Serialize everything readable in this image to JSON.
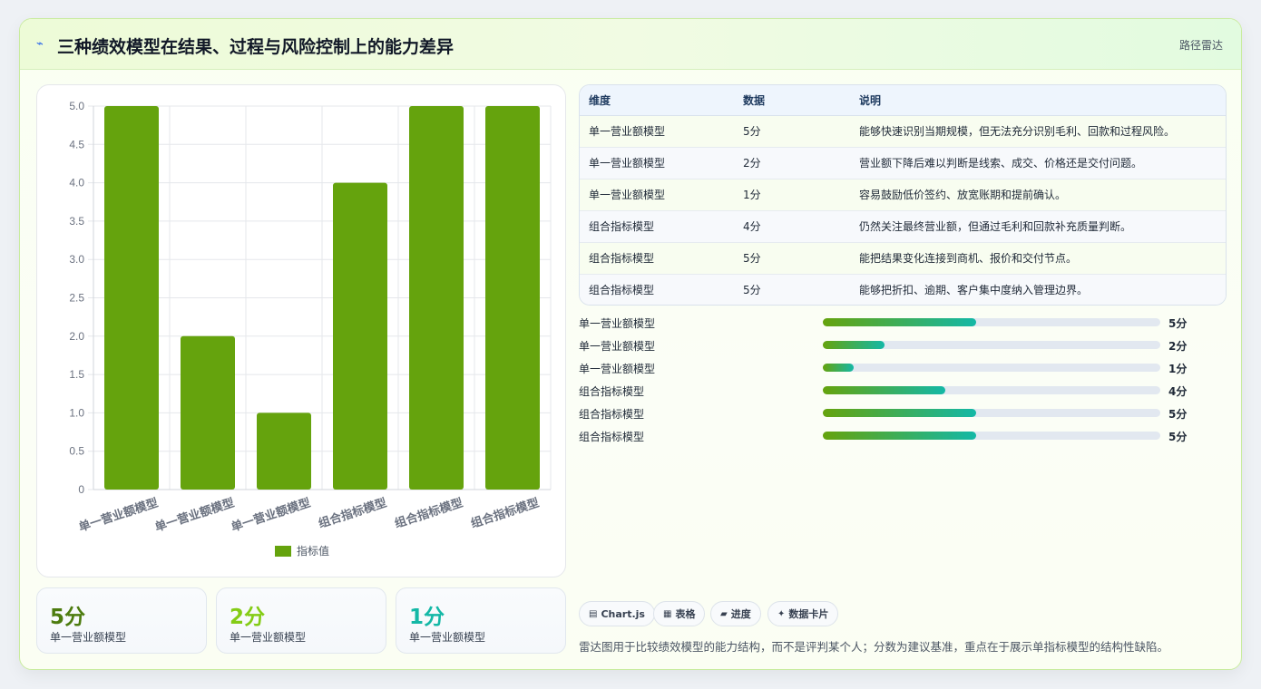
{
  "header": {
    "icon": "lightning-icon",
    "title": "三种绩效模型在结果、过程与风险控制上的能力差异",
    "tag": "路径雷达"
  },
  "chart_data": {
    "type": "bar",
    "categories": [
      "单一营业额模型",
      "单一营业额模型",
      "单一营业额模型",
      "组合指标模型",
      "组合指标模型",
      "组合指标模型"
    ],
    "series": [
      {
        "name": "指标值",
        "values": [
          5,
          2,
          1,
          4,
          5,
          5
        ],
        "color": "#65a30d"
      }
    ],
    "yticks": [
      "0",
      "0.5",
      "1.0",
      "1.5",
      "2.0",
      "2.5",
      "3.0",
      "3.5",
      "4.0",
      "4.5",
      "5.0"
    ],
    "ylim": [
      0,
      5
    ],
    "grid": true,
    "legend": "bottom"
  },
  "stats": [
    {
      "value": "5分",
      "label": "单一营业额模型",
      "color": "#4d7c0f"
    },
    {
      "value": "2分",
      "label": "单一营业额模型",
      "color": "#84cc16"
    },
    {
      "value": "1分",
      "label": "单一营业额模型",
      "color": "#14b8a6"
    }
  ],
  "table": {
    "headers": [
      "维度",
      "数据",
      "说明"
    ],
    "rows": [
      [
        "单一营业额模型",
        "5分",
        "能够快速识别当期规模，但无法充分识别毛利、回款和过程风险。"
      ],
      [
        "单一营业额模型",
        "2分",
        "营业额下降后难以判断是线索、成交、价格还是交付问题。"
      ],
      [
        "单一营业额模型",
        "1分",
        "容易鼓励低价签约、放宽账期和提前确认。"
      ],
      [
        "组合指标模型",
        "4分",
        "仍然关注最终营业额，但通过毛利和回款补充质量判断。"
      ],
      [
        "组合指标模型",
        "5分",
        "能把结果变化连接到商机、报价和交付节点。"
      ],
      [
        "组合指标模型",
        "5分",
        "能够把折扣、逾期、客户集中度纳入管理边界。"
      ]
    ]
  },
  "progress": [
    {
      "label": "单一营业额模型",
      "value": "5分",
      "fraction": 0.4545
    },
    {
      "label": "单一营业额模型",
      "value": "2分",
      "fraction": 0.1818
    },
    {
      "label": "单一营业额模型",
      "value": "1分",
      "fraction": 0.0909
    },
    {
      "label": "组合指标模型",
      "value": "4分",
      "fraction": 0.3636
    },
    {
      "label": "组合指标模型",
      "value": "5分",
      "fraction": 0.4545
    },
    {
      "label": "组合指标模型",
      "value": "5分",
      "fraction": 0.4545
    }
  ],
  "chips": [
    {
      "icon": "chart-icon",
      "glyph": "▤",
      "label": "Chart.js"
    },
    {
      "icon": "table-icon",
      "glyph": "▦",
      "label": "表格"
    },
    {
      "icon": "progress-icon",
      "glyph": "▰",
      "label": "进度"
    },
    {
      "icon": "sparkle-icon",
      "glyph": "✦",
      "label": "数据卡片"
    }
  ],
  "note": "雷达图用于比较绩效模型的能力结构，而不是评判某个人；分数为建议基准，重点在于展示单指标模型的结构性缺陷。"
}
